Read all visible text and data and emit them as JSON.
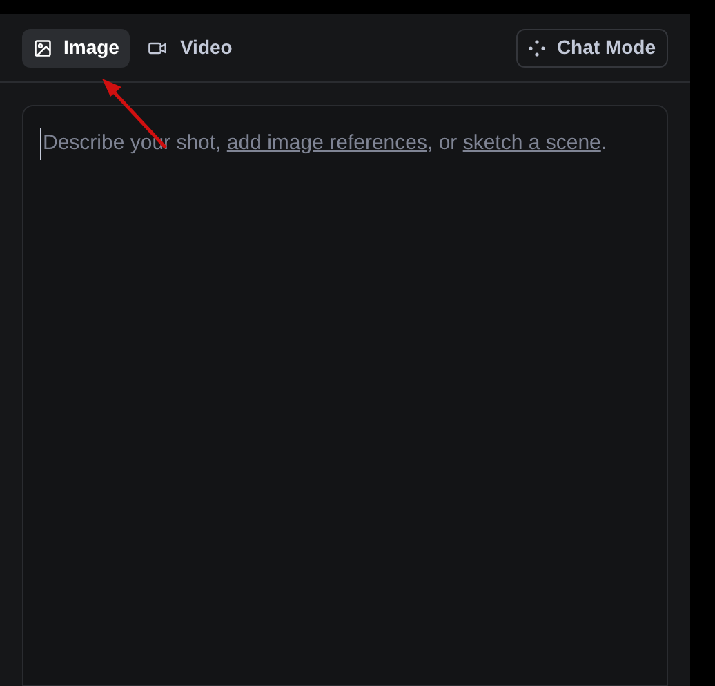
{
  "tabs": [
    {
      "label": "Image",
      "selected": true
    },
    {
      "label": "Video",
      "selected": false
    }
  ],
  "chat_mode_button": {
    "label": "Chat Mode"
  },
  "prompt": {
    "segments": [
      {
        "kind": "text",
        "text": "Describe your shot, "
      },
      {
        "kind": "link",
        "text": "add image references"
      },
      {
        "kind": "text",
        "text": ", or "
      },
      {
        "kind": "link",
        "text": "sketch a scene"
      },
      {
        "kind": "text",
        "text": "."
      }
    ]
  }
}
